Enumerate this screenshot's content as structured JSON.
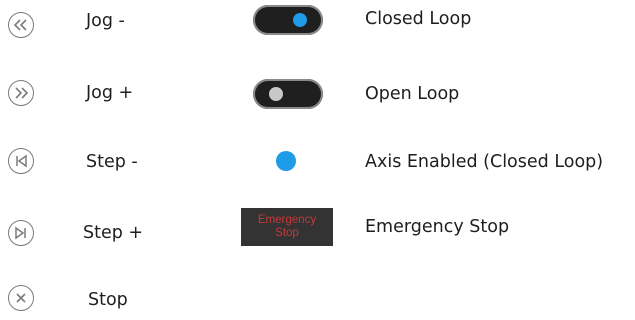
{
  "legend_left": [
    {
      "icon": "rewind-icon",
      "label": "Jog -"
    },
    {
      "icon": "fast-forward-icon",
      "label": "Jog +"
    },
    {
      "icon": "step-back-icon",
      "label": "Step -"
    },
    {
      "icon": "step-forward-icon",
      "label": "Step +"
    },
    {
      "icon": "stop-icon",
      "label": "Stop"
    }
  ],
  "legend_right": {
    "closed_loop": {
      "label": "Closed Loop",
      "state": "on",
      "knob_color": "#1e9be9"
    },
    "open_loop": {
      "label": "Open Loop",
      "state": "off",
      "knob_color": "#c8c8c8"
    },
    "axis_enabled": {
      "label": "Axis Enabled (Closed Loop)",
      "dot_color": "#1e9be9"
    },
    "emergency_stop": {
      "label": "Emergency Stop",
      "button_text": "Emergency\nStop",
      "button_text_color": "#c23a3a"
    }
  },
  "colors": {
    "icon_stroke": "#7b7b7b",
    "toggle_track": "#1f1f1f"
  }
}
